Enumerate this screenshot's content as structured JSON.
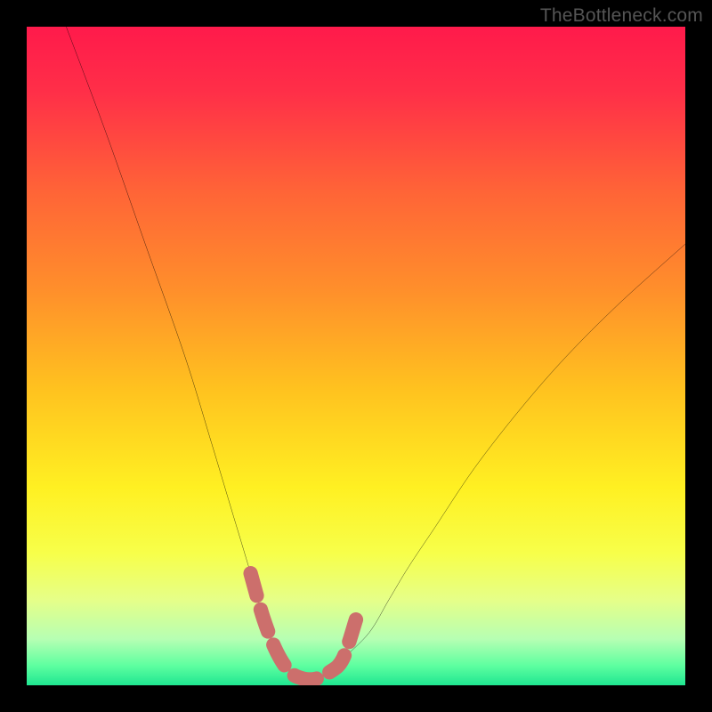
{
  "watermark": "TheBottleneck.com",
  "chart_data": {
    "type": "line",
    "title": "",
    "xlabel": "",
    "ylabel": "",
    "xlim": [
      0,
      100
    ],
    "ylim": [
      0,
      100
    ],
    "grid": false,
    "series": [
      {
        "name": "bottleneck-curve",
        "color": "#000000",
        "x": [
          6,
          12,
          18,
          24,
          28,
          31,
          34,
          36,
          38,
          40,
          42,
          44,
          46,
          48,
          52,
          55,
          58,
          62,
          68,
          75,
          82,
          90,
          100
        ],
        "y": [
          100,
          84,
          67,
          50,
          37,
          27,
          17,
          10,
          5,
          2,
          1,
          1,
          2,
          4,
          8,
          13,
          18,
          24,
          33,
          42,
          50,
          58,
          67
        ]
      },
      {
        "name": "optimal-range-marker",
        "color": "#cc6f6c",
        "x": [
          34,
          36,
          38,
          40,
          42,
          44,
          46,
          48,
          50
        ],
        "y": [
          17,
          10,
          5,
          2,
          1,
          1,
          2,
          4,
          10
        ]
      }
    ],
    "background_gradient_stops": [
      {
        "offset": 0.0,
        "color": "#ff1a4b"
      },
      {
        "offset": 0.1,
        "color": "#ff2f48"
      },
      {
        "offset": 0.25,
        "color": "#ff6437"
      },
      {
        "offset": 0.4,
        "color": "#ff8f2b"
      },
      {
        "offset": 0.55,
        "color": "#ffc21f"
      },
      {
        "offset": 0.7,
        "color": "#fff022"
      },
      {
        "offset": 0.8,
        "color": "#f7ff4a"
      },
      {
        "offset": 0.87,
        "color": "#e6ff88"
      },
      {
        "offset": 0.93,
        "color": "#b6ffb3"
      },
      {
        "offset": 0.97,
        "color": "#5effa0"
      },
      {
        "offset": 1.0,
        "color": "#1fe691"
      }
    ]
  }
}
